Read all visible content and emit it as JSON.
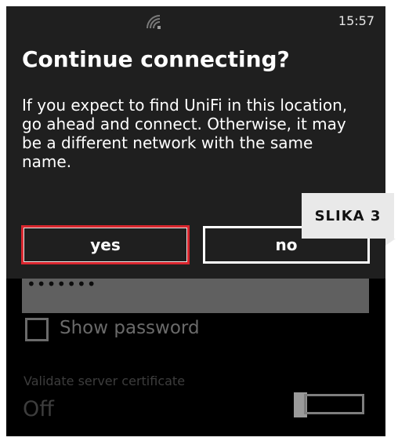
{
  "status_bar": {
    "time": "15:57",
    "signal_icon": "wifi-signal-icon"
  },
  "dialog": {
    "title": "Continue connecting?",
    "message": "If you expect to find UniFi in this location, go ahead and connect.  Otherwise, it may be a different network with the same name.",
    "yes_label": "yes",
    "no_label": "no"
  },
  "background_settings": {
    "password_value": "•••••••",
    "show_password_label": "Show password",
    "validate_label": "Validate server certificate",
    "validate_value": "Off"
  },
  "annotation": {
    "label": "SLIKA 3"
  },
  "colors": {
    "highlight": "#d9262e",
    "dialog_bg": "#1f1f1f",
    "screen_bg": "#000000"
  }
}
